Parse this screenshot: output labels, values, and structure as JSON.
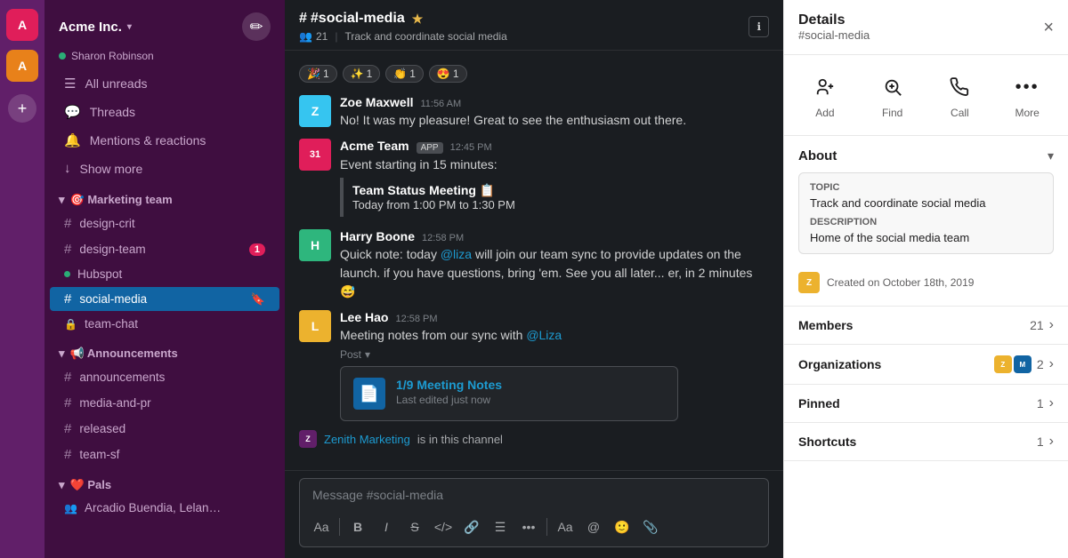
{
  "app": {
    "workspace": "Acme Inc.",
    "user": "Sharon Robinson",
    "channel": "#social-media",
    "channel_desc": "Track and coordinate social media"
  },
  "sidebar": {
    "nav": [
      {
        "label": "All unreads",
        "icon": "☰"
      },
      {
        "label": "Threads",
        "icon": "💬"
      },
      {
        "label": "Mentions & reactions",
        "icon": "🔔"
      },
      {
        "label": "Show more",
        "icon": "↓"
      }
    ],
    "sections": [
      {
        "label": "🎯 Marketing team",
        "channels": [
          {
            "type": "hash",
            "name": "design-crit",
            "badge": null,
            "active": false
          },
          {
            "type": "hash",
            "name": "design-team",
            "badge": "1",
            "active": false
          },
          {
            "type": "dot",
            "name": "Hubspot",
            "badge": null,
            "active": false
          },
          {
            "type": "hash",
            "name": "social-media",
            "badge": null,
            "active": true
          },
          {
            "type": "lock",
            "name": "team-chat",
            "badge": null,
            "active": false
          }
        ]
      },
      {
        "label": "📢 Announcements",
        "channels": [
          {
            "type": "hash",
            "name": "announcements",
            "badge": null,
            "active": false
          },
          {
            "type": "hash",
            "name": "media-and-pr",
            "badge": null,
            "active": false
          },
          {
            "type": "hash",
            "name": "released",
            "badge": null,
            "active": false
          },
          {
            "type": "hash",
            "name": "team-sf",
            "badge": null,
            "active": false
          }
        ]
      },
      {
        "label": "❤️ Pals",
        "channels": [
          {
            "type": "dm",
            "name": "Arcadio Buendia, Leland Ygle...",
            "badge": null,
            "active": false
          }
        ]
      }
    ]
  },
  "chat": {
    "member_count": "21",
    "reactions": [
      {
        "emoji": "🎉",
        "count": "1"
      },
      {
        "emoji": "✨",
        "count": "1"
      },
      {
        "emoji": "👏",
        "count": "1"
      },
      {
        "emoji": "😍",
        "count": "1"
      }
    ],
    "messages": [
      {
        "id": "msg1",
        "author": "Zoe Maxwell",
        "avatar_initials": "Z",
        "avatar_class": "avatar-zoe",
        "time": "11:56 AM",
        "app_badge": null,
        "text": "No! It was my pleasure! Great to see the enthusiasm out there."
      },
      {
        "id": "msg2",
        "author": "Acme Team",
        "avatar_initials": "31",
        "avatar_class": "avatar-acme",
        "time": "12:45 PM",
        "app_badge": "APP",
        "text": "Event starting in 15 minutes:",
        "quote_title": "Team Status Meeting 📋",
        "quote_sub": "Today from 1:00 PM to 1:30 PM"
      },
      {
        "id": "msg3",
        "author": "Harry Boone",
        "avatar_initials": "H",
        "avatar_class": "avatar-harry",
        "time": "12:58 PM",
        "text": "Quick note: today @liza will join our team sync to provide updates on the launch. if you have questions, bring 'em. See you all later... er, in 2 minutes 😅",
        "mention": "@liza"
      },
      {
        "id": "msg4",
        "author": "Lee Hao",
        "avatar_initials": "L",
        "avatar_class": "avatar-lee",
        "time": "12:58 PM",
        "text": "Meeting notes from our sync with @Liza",
        "post_label": "Post",
        "post_title": "1/9 Meeting Notes",
        "post_edited": "Last edited just now"
      }
    ],
    "zenith_row": "Zenith Marketing is in this channel",
    "input_placeholder": "Message #social-media"
  },
  "details": {
    "title": "Details",
    "channel": "#social-media",
    "close_label": "×",
    "actions": [
      {
        "icon": "👤",
        "label": "Add"
      },
      {
        "icon": "🔍",
        "label": "Find"
      },
      {
        "icon": "📞",
        "label": "Call"
      },
      {
        "icon": "•••",
        "label": "More"
      }
    ],
    "about_section": {
      "label": "About",
      "topic_label": "Topic",
      "topic_value": "Track and coordinate social media",
      "desc_label": "Description",
      "desc_value": "Home of the social media team",
      "creator": "Created on October 18th, 2019"
    },
    "members": {
      "label": "Members",
      "count": "21"
    },
    "organizations": {
      "label": "Organizations",
      "count": "2"
    },
    "pinned": {
      "label": "Pinned",
      "count": "1"
    },
    "shortcuts": {
      "label": "Shortcuts",
      "count": "1"
    }
  }
}
